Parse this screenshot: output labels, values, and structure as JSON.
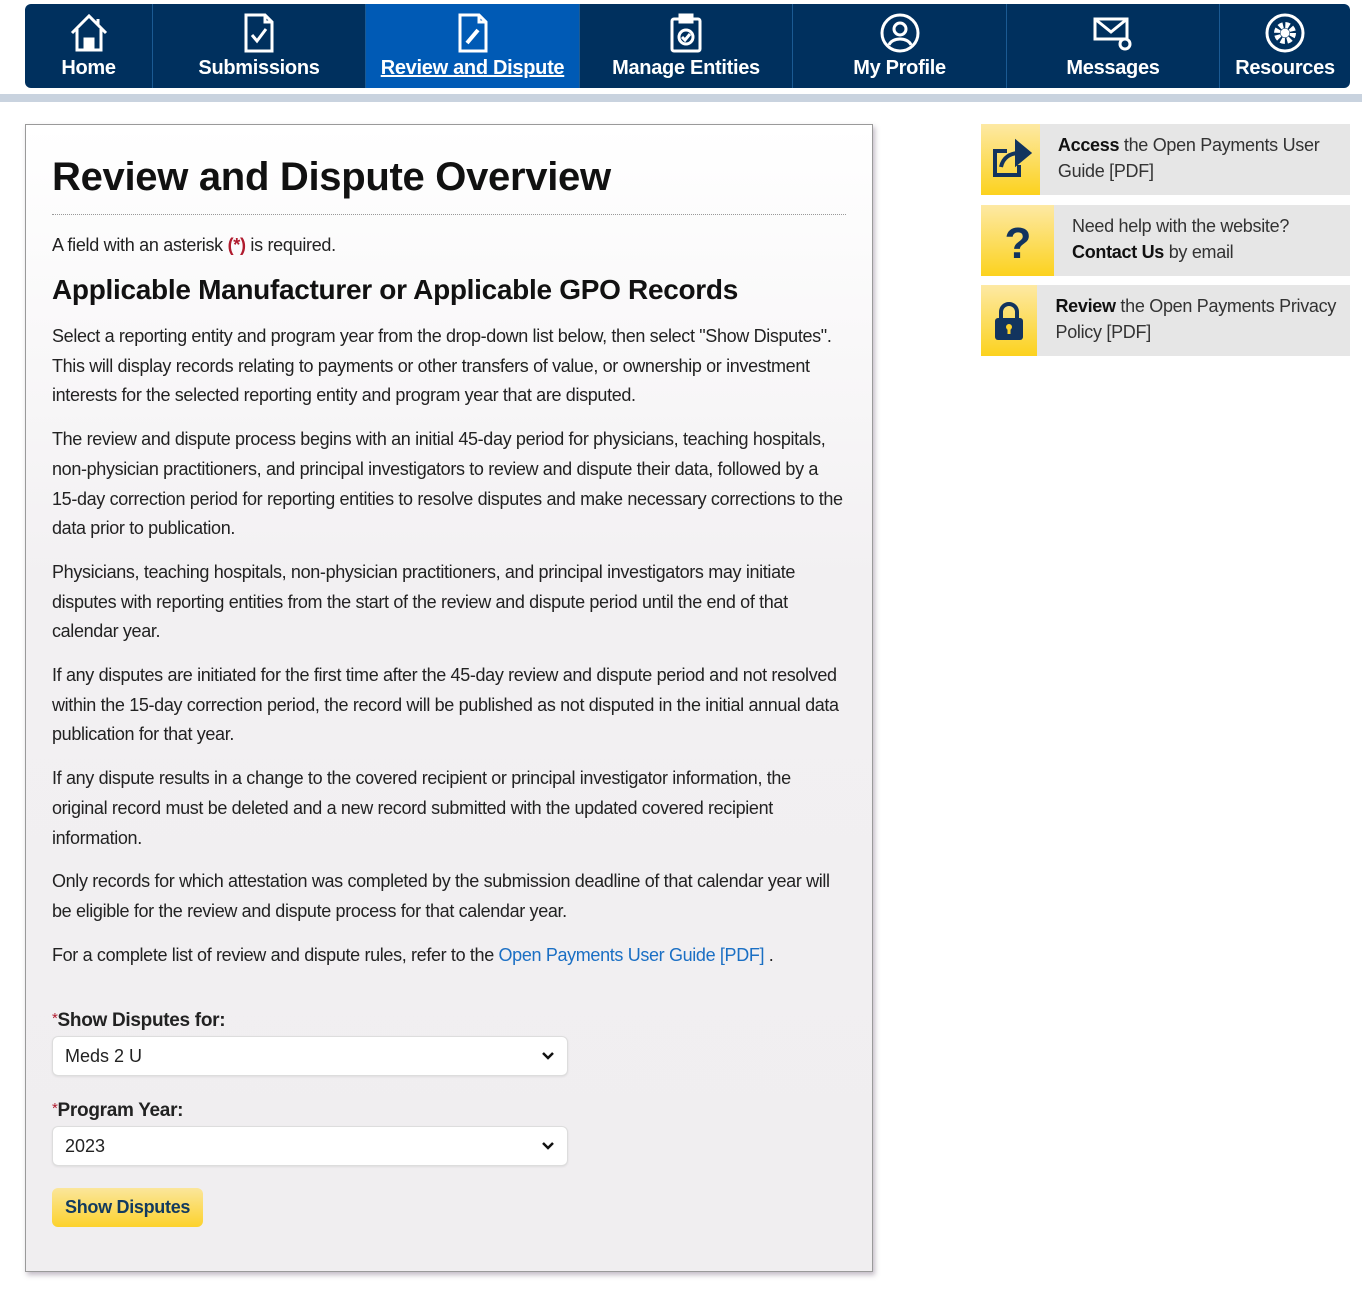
{
  "nav": {
    "items": [
      {
        "label": "Home",
        "icon": "home-icon"
      },
      {
        "label": "Submissions",
        "icon": "document-check-icon"
      },
      {
        "label": "Review and Dispute",
        "icon": "document-edit-icon",
        "active": true
      },
      {
        "label": "Manage Entities",
        "icon": "clipboard-check-icon"
      },
      {
        "label": "My Profile",
        "icon": "user-circle-icon"
      },
      {
        "label": "Messages",
        "icon": "envelope-icon"
      },
      {
        "label": "Resources",
        "icon": "gear-icon"
      }
    ]
  },
  "main": {
    "title": "Review and Dispute Overview",
    "required_note": {
      "before": "A field with an asterisk ",
      "asterisk": "(*)",
      "after": " is required."
    },
    "subtitle": "Applicable Manufacturer or Applicable GPO Records",
    "paragraphs": [
      "Select a reporting entity and program year from the drop-down list below, then select \"Show Disputes\". This will display records relating to payments or other transfers of value, or ownership or investment interests for the selected reporting entity and program year that are disputed.",
      "The review and dispute process begins with an initial 45-day period for physicians, teaching hospitals, non-physician practitioners, and principal investigators to review and dispute their data, followed by a 15-day correction period for reporting entities to resolve disputes and make necessary corrections to the data prior to publication.",
      "Physicians, teaching hospitals, non-physician practitioners, and principal investigators may initiate disputes with reporting entities from the start of the review and dispute period until the end of that calendar year.",
      "If any disputes are initiated for the first time after the 45-day review and dispute period and not resolved within the 15-day correction period, the record will be published as not disputed in the initial annual data publication for that year.",
      "If any dispute results in a change to the covered recipient or principal investigator information, the original record must be deleted and a new record submitted with the updated covered recipient information.",
      "Only records for which attestation was completed by the submission deadline of that calendar year will be eligible for the review and dispute process for that calendar year."
    ],
    "rules": {
      "before": "For a complete list of review and dispute rules, refer to the ",
      "link": "Open Payments User Guide [PDF]",
      "after": " ."
    },
    "form": {
      "required_mark": "*",
      "entity_label": "Show Disputes for:",
      "entity_value": "Meds 2 U",
      "year_label": "Program Year:",
      "year_value": "2023",
      "submit": "Show Disputes"
    }
  },
  "sidebar": [
    {
      "icon": "share-icon",
      "bold": "Access",
      "text": " the Open Payments User Guide [PDF]"
    },
    {
      "icon": "question-icon",
      "text1": "Need help with the website? ",
      "bold": "Contact Us",
      "text2": " by email"
    },
    {
      "icon": "lock-icon",
      "bold": "Review",
      "text": " the Open Payments Privacy Policy [PDF]"
    }
  ],
  "colors": {
    "nav": "#00305e",
    "nav_active": "#005ab5",
    "accent_yellow": "#fcd22c",
    "required": "#b01b2e",
    "link": "#1a6fc4"
  }
}
